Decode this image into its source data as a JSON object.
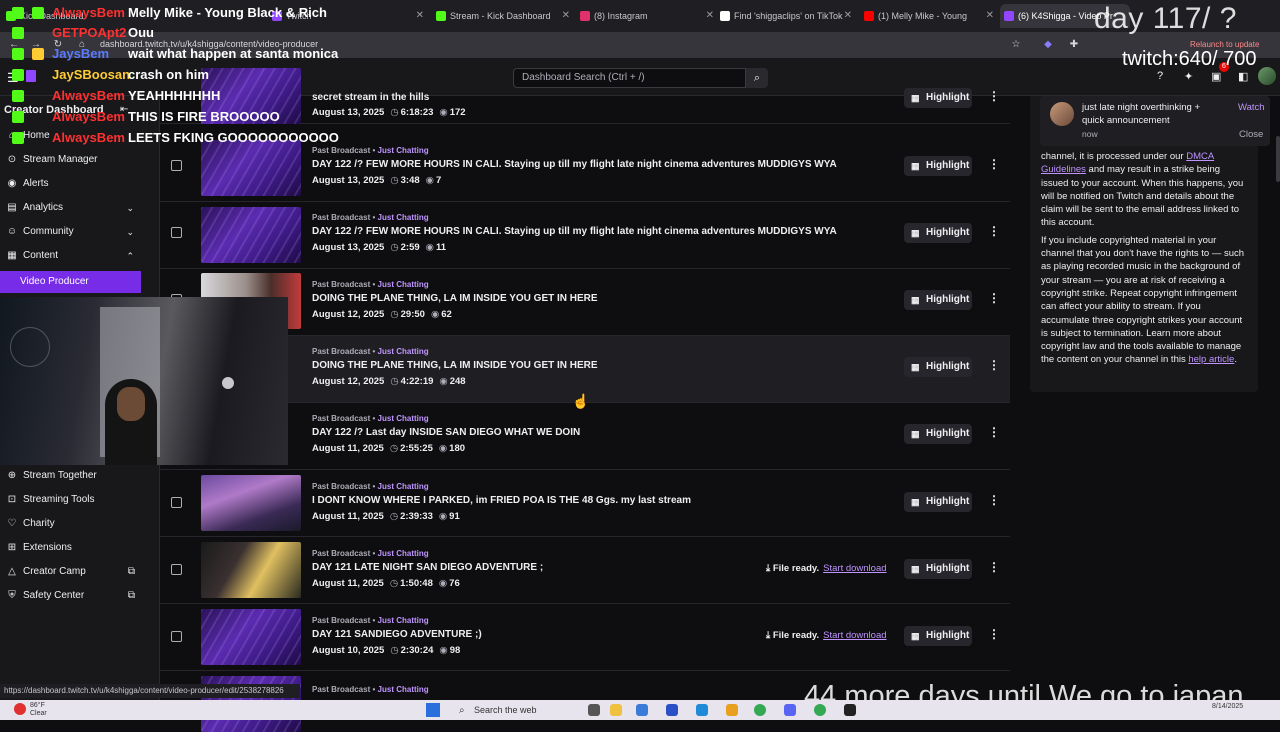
{
  "browser": {
    "tabs": [
      {
        "label": "Kick Dashboard",
        "color": "#53fc18"
      },
      {
        "label": "Twitch",
        "color": "#9146ff"
      },
      {
        "label": "Stream - Kick Dashboard",
        "color": "#53fc18"
      },
      {
        "label": "(8) Instagram",
        "color": "#e1306c"
      },
      {
        "label": "Find 'shiggaclips' on TikTok",
        "color": "#ffffff"
      },
      {
        "label": "(1) Melly Mike - Young",
        "color": "#ff0000"
      },
      {
        "label": "(6) K4Shigga - Video Pr",
        "color": "#9146ff"
      }
    ],
    "url": "dashboard.twitch.tv/u/k4shigga/content/video-producer",
    "relaunch_label": "Relaunch to update",
    "status_url": "https://dashboard.twitch.tv/u/k4shigga/content/video-producer/edit/2538278826"
  },
  "topbar": {
    "title": "Creator Dashboard",
    "search_placeholder": "Dashboard Search (Ctrl + /)",
    "notif_count": "6"
  },
  "sidebar": {
    "items": [
      {
        "label": "Home"
      },
      {
        "label": "Stream Manager"
      },
      {
        "label": "Alerts"
      },
      {
        "label": "Analytics"
      },
      {
        "label": "Community"
      },
      {
        "label": "Content"
      },
      {
        "label": "Video Producer"
      },
      {
        "label": "Stream Together"
      },
      {
        "label": "Streaming Tools"
      },
      {
        "label": "Charity"
      },
      {
        "label": "Extensions"
      },
      {
        "label": "Creator Camp"
      },
      {
        "label": "Safety Center"
      }
    ]
  },
  "videos": {
    "rows": [
      {
        "type": "",
        "category": "",
        "title": "secret stream in the hills",
        "date": "August 13, 2025",
        "duration": "6:18:23",
        "views": "172",
        "file_ready": false
      },
      {
        "type": "Past Broadcast",
        "category": "Just Chatting",
        "title": "DAY 122 /? FEW MORE HOURS IN CALI. Staying up till my flight late night cinema adventures MUDDIGYS WYA",
        "date": "August 13, 2025",
        "duration": "3:48",
        "views": "7",
        "file_ready": false
      },
      {
        "type": "Past Broadcast",
        "category": "Just Chatting",
        "title": "DAY 122 /? FEW MORE HOURS IN CALI. Staying up till my flight late night cinema adventures MUDDIGYS WYA",
        "date": "August 13, 2025",
        "duration": "2:59",
        "views": "11",
        "file_ready": false
      },
      {
        "type": "Past Broadcast",
        "category": "Just Chatting",
        "title": "DOING THE PLANE THING, LA IM INSIDE YOU GET IN HERE",
        "date": "August 12, 2025",
        "duration": "29:50",
        "views": "62",
        "file_ready": false
      },
      {
        "type": "Past Broadcast",
        "category": "Just Chatting",
        "title": "DOING THE PLANE THING, LA IM INSIDE YOU GET IN HERE",
        "date": "August 12, 2025",
        "duration": "4:22:19",
        "views": "248",
        "file_ready": false
      },
      {
        "type": "Past Broadcast",
        "category": "Just Chatting",
        "title": "DAY 122 /? Last day INSIDE SAN DIEGO WHAT WE DOIN",
        "date": "August 11, 2025",
        "duration": "2:55:25",
        "views": "180",
        "file_ready": false
      },
      {
        "type": "Past Broadcast",
        "category": "Just Chatting",
        "title": "I DONT KNOW WHERE I PARKED, im FRIED POA IS THE 48 Ggs. my last stream",
        "date": "August 11, 2025",
        "duration": "2:39:33",
        "views": "91",
        "file_ready": false
      },
      {
        "type": "Past Broadcast",
        "category": "Just Chatting",
        "title": "DAY 121 LATE NIGHT SAN DIEGO ADVENTURE ;",
        "date": "August 11, 2025",
        "duration": "1:50:48",
        "views": "76",
        "file_ready": true
      },
      {
        "type": "Past Broadcast",
        "category": "Just Chatting",
        "title": "DAY 121 SANDIEGO ADVENTURE ;)",
        "date": "August 10, 2025",
        "duration": "2:30:24",
        "views": "98",
        "file_ready": true
      },
      {
        "type": "Past Broadcast",
        "category": "Just Chatting",
        "title": "",
        "date": "",
        "duration": "",
        "views": "",
        "file_ready": false
      }
    ],
    "highlight_label": "Highlight",
    "file_ready_label": "File ready.",
    "start_download_label": "Start download",
    "type_sep": "•"
  },
  "info_panel": {
    "p1_a": "channel, it is processed under our ",
    "p1_link": "DMCA Guidelines",
    "p1_b": " and may result in a strike being issued to your account. When this happens, you will be notified on Twitch and details about the claim will be sent to the email address linked to this account.",
    "p2_a": "If you include copyrighted material in your channel that you don't have the rights to — such as playing recorded music in the background of your stream — you are at risk of receiving a copyright strike. Repeat copyright infringement can affect your ability to stream. If you accumulate three copyright strikes your account is subject to termination. Learn more about copyright law and the tools available to manage the content on your channel in this ",
    "p2_link": "help article",
    "p2_b": "."
  },
  "notification": {
    "text": "just late night overthinking + quick announcement",
    "time": "now",
    "watch": "Watch",
    "close": "Close"
  },
  "overlay": {
    "day_counter": "day 117/ ?",
    "sub_goal": "twitch:640/ 700",
    "countdown": "44 more days until We go to japan",
    "chat": [
      {
        "user": "AlwaysBem",
        "msg": "Melly Mike - Young Black & Rich",
        "color": "#ff3030"
      },
      {
        "user": "GETPOApt2",
        "msg": "Ouu",
        "color": "#ff3030"
      },
      {
        "user": "JaysBem",
        "msg": "wait what happen at santa monica",
        "color": "#5b7bff"
      },
      {
        "user": "JaySBoosan",
        "msg": "crash on him",
        "color": "#ffcc33"
      },
      {
        "user": "AlwaysBem",
        "msg": "YEAHHHHHHH",
        "color": "#ff3030"
      },
      {
        "user": "AlwaysBem",
        "msg": "THIS IS FIRE BROOOOO",
        "color": "#ff3030"
      },
      {
        "user": "AlwaysBem",
        "msg": "LEETS FKING GOOOOOOOOOOO",
        "color": "#ff3030"
      }
    ]
  },
  "taskbar": {
    "weather_temp": "86°F",
    "weather_desc": "Clear",
    "search_label": "Search the web",
    "date": "8/14/2025"
  }
}
